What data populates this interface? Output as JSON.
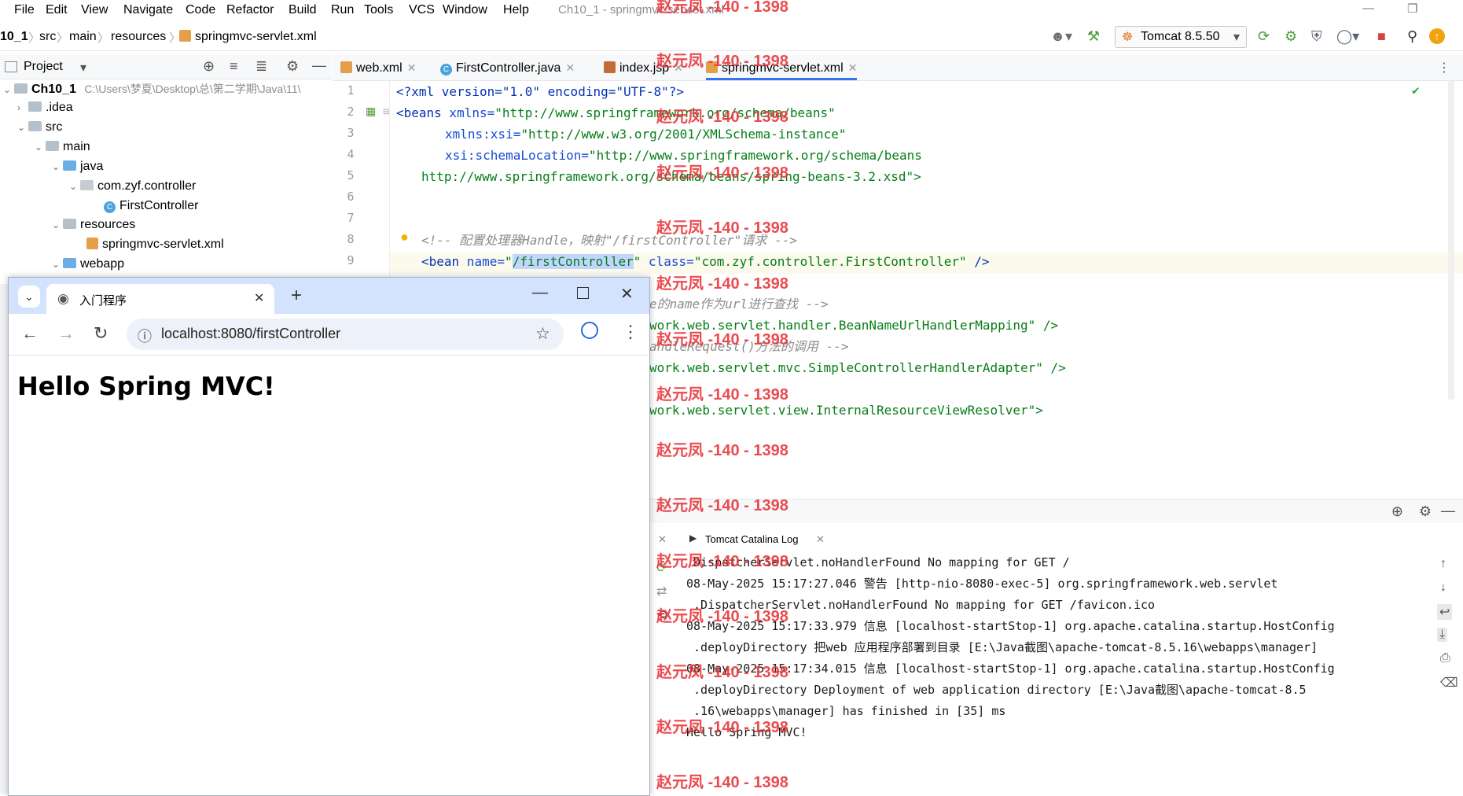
{
  "menu": [
    "File",
    "Edit",
    "View",
    "Navigate",
    "Code",
    "Refactor",
    "Build",
    "Run",
    "Tools",
    "VCS",
    "Window",
    "Help"
  ],
  "window_title": "Ch10_1 - springmvc-servlet.xml",
  "breadcrumb": [
    "10_1",
    "src",
    "main",
    "resources",
    "springmvc-servlet.xml"
  ],
  "run_config": "Tomcat 8.5.50",
  "project_panel": {
    "title": "Project"
  },
  "tree": {
    "root": "Ch10_1",
    "root_path": "C:\\Users\\梦夏\\Desktop\\总\\第二学期\\Java\\11\\",
    "idea": ".idea",
    "src": "src",
    "main": "main",
    "java": "java",
    "pkg": "com.zyf.controller",
    "cls": "FirstController",
    "resources": "resources",
    "xml": "springmvc-servlet.xml",
    "webapp": "webapp"
  },
  "editor_tabs": [
    "web.xml",
    "FirstController.java",
    "index.jsp",
    "springmvc-servlet.xml"
  ],
  "line_numbers": [
    "1",
    "2",
    "3",
    "4",
    "5",
    "6",
    "7",
    "8",
    "9"
  ],
  "code": {
    "l1": "<?xml version=\"1.0\" encoding=\"UTF-8\"?>",
    "l2_tag": "<beans",
    "l2_attr": " xmlns=",
    "l2_val": "\"http://www.springframework.org/schema/beans\"",
    "l3_attr": "xmlns:xsi=",
    "l3_val": "\"http://www.w3.org/2001/XMLSchema-instance\"",
    "l4_attr": "xsi:schemaLocation=",
    "l4_val": "\"http://www.springframework.org/schema/beans",
    "l5_val": "http://www.springframework.org/schema/beans/spring-beans-3.2.xsd\">",
    "l8": "<!-- 配置处理器Handle，映射\"/firstController\"请求 -->",
    "l9_tag": "<bean",
    "l9_attr1": " name=",
    "l9_q1": "\"",
    "l9_sel": "/firstController",
    "l9_q2": "\"",
    "l9_attr2": " class=",
    "l9_val2": "\"com.zyf.controller.FirstController\"",
    "l9_end": " />",
    "l10": "e的name作为url进行查找 -->",
    "l11": "work.web.servlet.handler.BeanNameUrlHandlerMapping\" />",
    "l12": "andleRequest()方法的调用 -->",
    "l13": "work.web.servlet.mvc.SimpleControllerHandlerAdapter\" />",
    "l14": "work.web.servlet.view.InternalResourceViewResolver\">"
  },
  "log_tab": "Tomcat Catalina Log",
  "log_lines": [
    ".DispatcherServlet.noHandlerFound No mapping for GET /",
    "08-May-2025 15:17:27.046 警告 [http-nio-8080-exec-5] org.springframework.web.servlet",
    " .DispatcherServlet.noHandlerFound No mapping for GET /favicon.ico",
    "08-May-2025 15:17:33.979 信息 [localhost-startStop-1] org.apache.catalina.startup.HostConfig",
    " .deployDirectory 把web 应用程序部署到目录 [E:\\Java截图\\apache-tomcat-8.5.16\\webapps\\manager]",
    "08-May-2025 15:17:34.015 信息 [localhost-startStop-1] org.apache.catalina.startup.HostConfig",
    " .deployDirectory Deployment of web application directory [E:\\Java截图\\apache-tomcat-8.5",
    " .16\\webapps\\manager] has finished in [35] ms",
    "Hello Spring MVC!"
  ],
  "watermark": "赵元凤 -140 - 1398",
  "browser": {
    "tab_title": "入门程序",
    "url": "localhost:8080/firstController",
    "heading": "Hello Spring MVC!"
  },
  "colors": {
    "accent": "#3574f0",
    "watermark": "#e8383d",
    "chrome_tabstrip": "#d3e3fd"
  }
}
